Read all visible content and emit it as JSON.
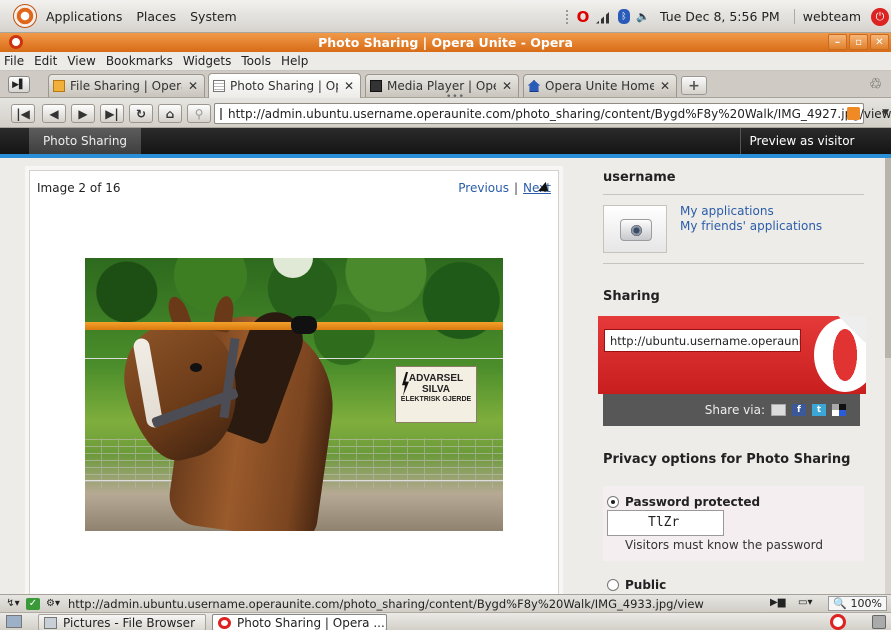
{
  "top_panel": {
    "menus": [
      "Applications",
      "Places",
      "System"
    ],
    "clock": "Tue Dec  8,  5:56 PM",
    "user": "webteam"
  },
  "window": {
    "title": "Photo Sharing | Opera Unite - Opera"
  },
  "menubar": [
    "File",
    "Edit",
    "View",
    "Bookmarks",
    "Widgets",
    "Tools",
    "Help"
  ],
  "tabs": [
    {
      "label": "File Sharing | Opera...",
      "icon": "folder-icon"
    },
    {
      "label": "Photo Sharing | Op...",
      "icon": "photo-icon",
      "active": true
    },
    {
      "label": "Media Player | Oper...",
      "icon": "media-icon"
    },
    {
      "label": "Opera Unite Home |...",
      "icon": "home-icon"
    }
  ],
  "address_bar": {
    "url": "http://admin.ubuntu.username.operaunite.com/photo_sharing/content/Bygd%F8y%20Walk/IMG_4927.jpg/view"
  },
  "unite_bar": {
    "app_name": "Photo Sharing",
    "preview_label": "Preview as visitor"
  },
  "photo_viewer": {
    "counter": "Image 2 of 16",
    "previous_label": "Previous",
    "next_label": "Next",
    "sign_line1": "ADVARSEL",
    "sign_line2": "SILVA",
    "sign_line3": "ELEKTRISK GJERDE"
  },
  "sidebar": {
    "username": "username",
    "my_applications": "My applications",
    "friends_applications": "My friends' applications",
    "sharing_heading": "Sharing",
    "share_url": "http://ubuntu.username.operaunite",
    "share_via_label": "Share via:",
    "privacy_heading": "Privacy options for Photo Sharing",
    "password_option": "Password protected",
    "password_value": "TlZr",
    "password_help": "Visitors must know the password",
    "public_option": "Public"
  },
  "statusbar": {
    "url": "http://admin.ubuntu.username.operaunite.com/photo_sharing/content/Bygd%F8y%20Walk/IMG_4933.jpg/view",
    "zoom": "100%"
  },
  "taskbar": {
    "items": [
      "Pictures - File Browser",
      "Photo Sharing | Opera ..."
    ]
  },
  "colors": {
    "accent_blue": "#2a8fd6",
    "opera_red": "#d22222",
    "titlebar_orange": "#e07a22",
    "link_blue": "#2a5da8"
  }
}
